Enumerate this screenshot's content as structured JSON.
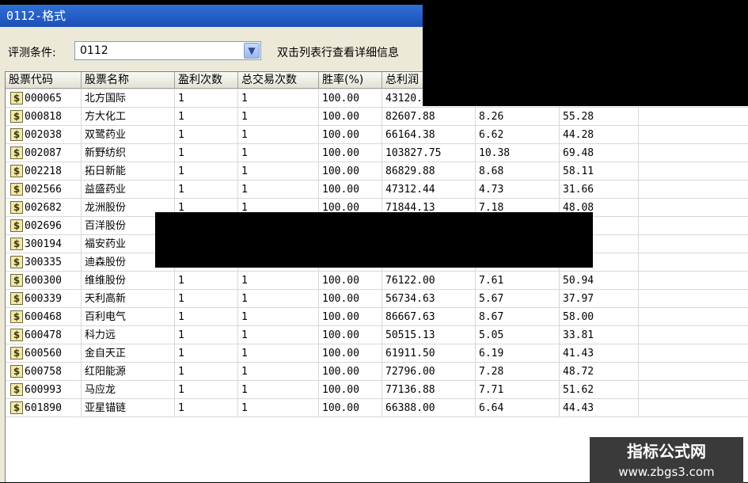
{
  "window": {
    "title": "0112-格式"
  },
  "condition": {
    "label": "评测条件:",
    "value": "0112",
    "hint": "双击列表行查看详细信息"
  },
  "table": {
    "columns": [
      "股票代码",
      "股票名称",
      "盈利次数",
      "总交易次数",
      "胜率(%)",
      "总利润"
    ],
    "rows": [
      {
        "code": "000065",
        "name": "北方国际",
        "wins": "1",
        "trades": "1",
        "rate": "100.00",
        "profit": "43120.",
        "c6": "",
        "c7": ""
      },
      {
        "code": "000818",
        "name": "方大化工",
        "wins": "1",
        "trades": "1",
        "rate": "100.00",
        "profit": "82607.88",
        "c6": "8.26",
        "c7": "55.28"
      },
      {
        "code": "002038",
        "name": "双鹭药业",
        "wins": "1",
        "trades": "1",
        "rate": "100.00",
        "profit": "66164.38",
        "c6": "6.62",
        "c7": "44.28"
      },
      {
        "code": "002087",
        "name": "新野纺织",
        "wins": "1",
        "trades": "1",
        "rate": "100.00",
        "profit": "103827.75",
        "c6": "10.38",
        "c7": "69.48"
      },
      {
        "code": "002218",
        "name": "拓日新能",
        "wins": "1",
        "trades": "1",
        "rate": "100.00",
        "profit": "86829.88",
        "c6": "8.68",
        "c7": "58.11"
      },
      {
        "code": "002566",
        "name": "益盛药业",
        "wins": "1",
        "trades": "1",
        "rate": "100.00",
        "profit": "47312.44",
        "c6": "4.73",
        "c7": "31.66"
      },
      {
        "code": "002682",
        "name": "龙洲股份",
        "wins": "1",
        "trades": "1",
        "rate": "100.00",
        "profit": "71844.13",
        "c6": "7.18",
        "c7": "48.08"
      },
      {
        "code": "002696",
        "name": "百洋股份",
        "wins": "",
        "trades": "",
        "rate": "",
        "profit": "",
        "c6": "",
        "c7": ""
      },
      {
        "code": "300194",
        "name": "福安药业",
        "wins": "",
        "trades": "",
        "rate": "",
        "profit": "",
        "c6": "",
        "c7": ""
      },
      {
        "code": "300335",
        "name": "迪森股份",
        "wins": "",
        "trades": "",
        "rate": "",
        "profit": "",
        "c6": "",
        "c7": ""
      },
      {
        "code": "600300",
        "name": "维维股份",
        "wins": "1",
        "trades": "1",
        "rate": "100.00",
        "profit": "76122.00",
        "c6": "7.61",
        "c7": "50.94"
      },
      {
        "code": "600339",
        "name": "天利高新",
        "wins": "1",
        "trades": "1",
        "rate": "100.00",
        "profit": "56734.63",
        "c6": "5.67",
        "c7": "37.97"
      },
      {
        "code": "600468",
        "name": "百利电气",
        "wins": "1",
        "trades": "1",
        "rate": "100.00",
        "profit": "86667.63",
        "c6": "8.67",
        "c7": "58.00"
      },
      {
        "code": "600478",
        "name": "科力远",
        "wins": "1",
        "trades": "1",
        "rate": "100.00",
        "profit": "50515.13",
        "c6": "5.05",
        "c7": "33.81"
      },
      {
        "code": "600560",
        "name": "金自天正",
        "wins": "1",
        "trades": "1",
        "rate": "100.00",
        "profit": "61911.50",
        "c6": "6.19",
        "c7": "41.43"
      },
      {
        "code": "600758",
        "name": "红阳能源",
        "wins": "1",
        "trades": "1",
        "rate": "100.00",
        "profit": "72796.00",
        "c6": "7.28",
        "c7": "48.72"
      },
      {
        "code": "600993",
        "name": "马应龙",
        "wins": "1",
        "trades": "1",
        "rate": "100.00",
        "profit": "77136.88",
        "c6": "7.71",
        "c7": "51.62"
      },
      {
        "code": "601890",
        "name": "亚星锚链",
        "wins": "1",
        "trades": "1",
        "rate": "100.00",
        "profit": "66388.00",
        "c6": "6.64",
        "c7": "44.43"
      }
    ]
  },
  "watermark": {
    "line1": "指标公式网",
    "line2": "www.zbgs3.com"
  },
  "icons": {
    "row_icon": "dollar-icon",
    "dropdown": "chevron-down-icon"
  },
  "colors": {
    "title_bar": "#1c4fb8",
    "window_bg": "#ece9d8"
  }
}
